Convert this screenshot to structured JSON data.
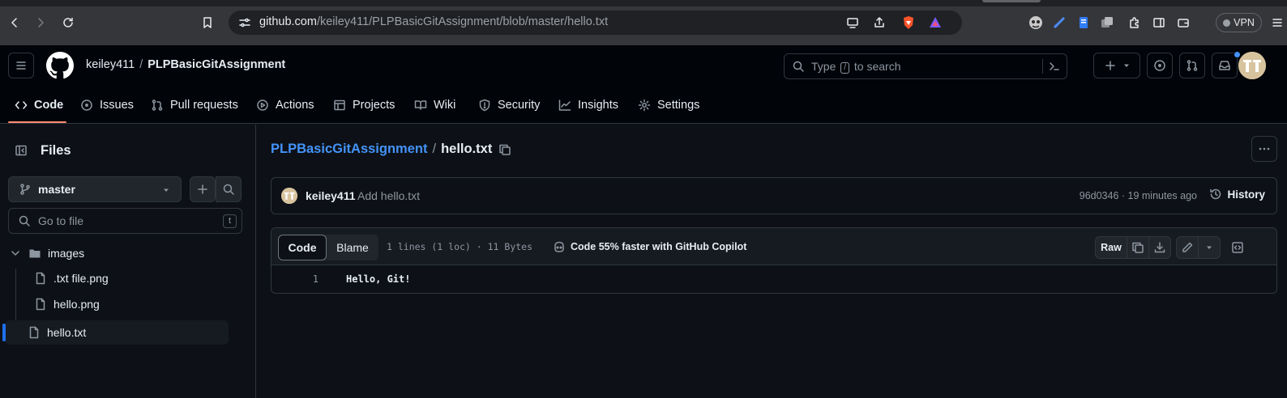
{
  "browser": {
    "url_host": "github.com",
    "url_path": "/keiley411/PLPBasicGitAssignment/blob/master/hello.txt",
    "vpn_label": "VPN"
  },
  "header": {
    "owner": "keiley411",
    "separator": "/",
    "repo": "PLPBasicGitAssignment",
    "search_prefix": "Type",
    "search_key": "/",
    "search_suffix": "to search"
  },
  "repo_tabs": [
    {
      "label": "Code",
      "icon": "code-icon"
    },
    {
      "label": "Issues",
      "icon": "issue-opened-icon"
    },
    {
      "label": "Pull requests",
      "icon": "git-pull-request-icon"
    },
    {
      "label": "Actions",
      "icon": "play-icon"
    },
    {
      "label": "Projects",
      "icon": "table-icon"
    },
    {
      "label": "Wiki",
      "icon": "book-icon"
    },
    {
      "label": "Security",
      "icon": "shield-icon"
    },
    {
      "label": "Insights",
      "icon": "graph-icon"
    },
    {
      "label": "Settings",
      "icon": "gear-icon"
    }
  ],
  "sidebar": {
    "title": "Files",
    "branch": "master",
    "goto_placeholder": "Go to file",
    "goto_shortcut": "t",
    "tree": [
      {
        "name": "images",
        "type": "folder"
      },
      {
        "name": ".txt file.png",
        "type": "file"
      },
      {
        "name": "hello.png",
        "type": "file"
      },
      {
        "name": "hello.txt",
        "type": "file",
        "selected": true
      }
    ]
  },
  "breadcrumb": {
    "repo": "PLPBasicGitAssignment",
    "separator": "/",
    "file": "hello.txt"
  },
  "commit": {
    "author": "keiley411",
    "message": "Add hello.txt",
    "meta": "96d0346 · 19 minutes ago",
    "history_label": "History"
  },
  "file_view": {
    "code_tab": "Code",
    "blame_tab": "Blame",
    "info": "1 lines (1 loc) · 11 Bytes",
    "copilot": "Code 55% faster with GitHub Copilot",
    "raw_label": "Raw",
    "lines": [
      {
        "number": "1",
        "text": "Hello, Git!"
      }
    ]
  },
  "colors": {
    "background": "#0d1117",
    "header_bg": "#010409",
    "link": "#4493f8",
    "tab_underline": "#fd8c73",
    "selection_bar": "#1f6feb"
  }
}
